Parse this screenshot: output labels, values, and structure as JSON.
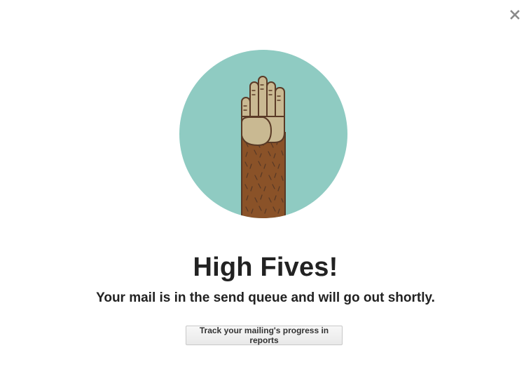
{
  "dialog": {
    "title": "High Fives!",
    "message": "Your mail is in the send queue and will go out shortly.",
    "cta_label": "Track your mailing's progress in reports",
    "close_icon": "close-icon",
    "hero_icon": "high-five-hand-icon"
  },
  "colors": {
    "circle": "#8fcbc2",
    "arm": "#8a5228",
    "hand": "#c9b992",
    "outline": "#5a3a26",
    "text": "#222222"
  }
}
